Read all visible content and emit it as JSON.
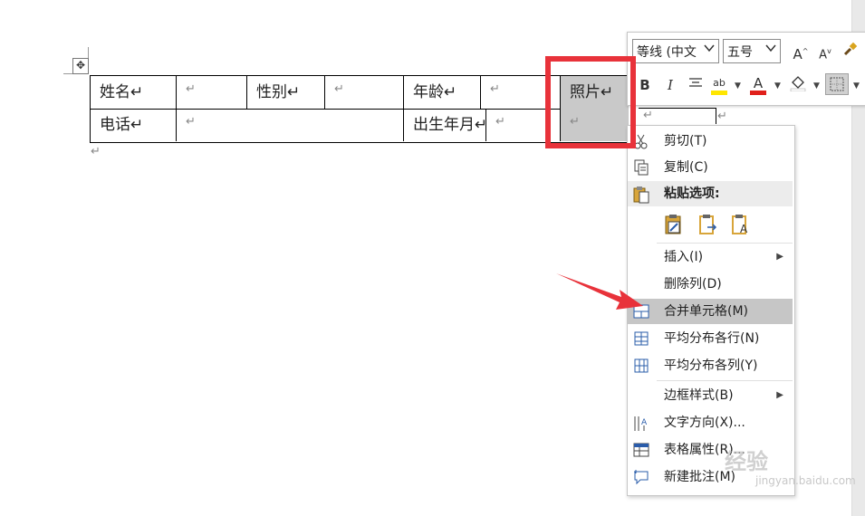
{
  "document": {
    "row1": {
      "c1": "姓名↵",
      "c2": "↵",
      "c3": "性别↵",
      "c4": "↵",
      "c5": "年龄↵",
      "c6": "↵",
      "c7": "照片↵"
    },
    "row2": {
      "c1": "电话↵",
      "c2": "↵",
      "c3": "出生年月↵",
      "c4": "↵",
      "c5": "↵"
    },
    "end_mark": "↵",
    "stray_mark_1": "↵",
    "stray_mark_2": "↵"
  },
  "mini_toolbar": {
    "font_name": "等线 (中文",
    "font_size": "五号",
    "grow_font": "A",
    "shrink_font": "A",
    "bold": "B",
    "italic": "I",
    "highlight": "ab",
    "font_color": "A"
  },
  "context_menu": {
    "items": [
      {
        "label": "剪切(T)",
        "icon": "scissors-icon"
      },
      {
        "label": "复制(C)",
        "icon": "copy-icon"
      },
      {
        "label": "粘贴选项:",
        "icon": "paste-icon"
      },
      {
        "label": "插入(I)",
        "icon": ""
      },
      {
        "label": "删除列(D)",
        "icon": ""
      },
      {
        "label": "合并单元格(M)",
        "icon": "merge-cells-icon"
      },
      {
        "label": "平均分布各行(N)",
        "icon": "distribute-rows-icon"
      },
      {
        "label": "平均分布各列(Y)",
        "icon": "distribute-columns-icon"
      },
      {
        "label": "边框样式(B)",
        "icon": ""
      },
      {
        "label": "文字方向(X)...",
        "icon": "text-direction-icon"
      },
      {
        "label": "表格属性(R)...",
        "icon": "table-properties-icon"
      },
      {
        "label": "新建批注(M)",
        "icon": "new-comment-icon"
      }
    ]
  },
  "watermark": {
    "text": "经验",
    "sub": "jingyan.baidu.com"
  },
  "colors": {
    "accent_red": "#e8323a",
    "highlight_gray": "#c6c6c6",
    "font_color_red": "#e0201b",
    "highlight_yellow": "#ffe600"
  }
}
